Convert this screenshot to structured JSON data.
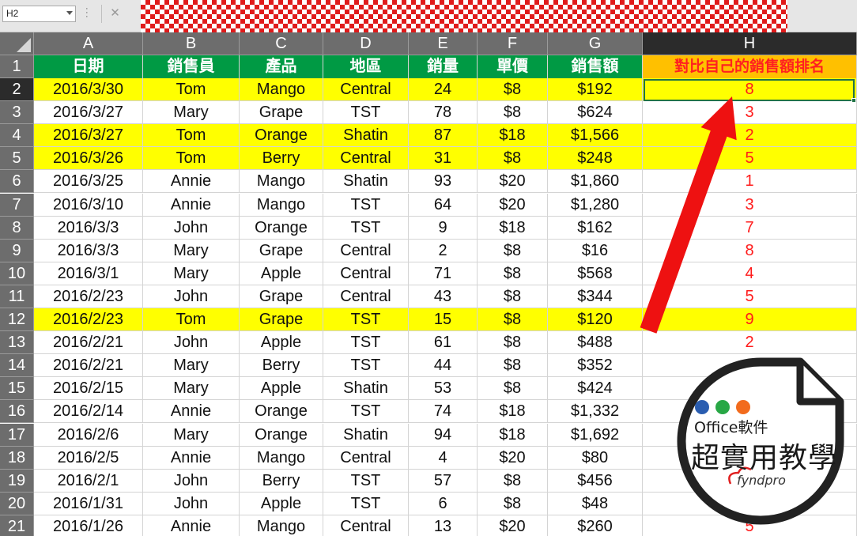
{
  "namebox": "H2",
  "fx_cancel": "✕",
  "columns": [
    "A",
    "B",
    "C",
    "D",
    "E",
    "F",
    "G",
    "H"
  ],
  "selected_column": "H",
  "selected_row": "2",
  "headers": [
    "日期",
    "銷售員",
    "產品",
    "地區",
    "銷量",
    "單價",
    "銷售額",
    "對比自己的銷售額排名"
  ],
  "rows": [
    {
      "n": "2",
      "cells": [
        "2016/3/30",
        "Tom",
        "Mango",
        "Central",
        "24",
        "$8",
        "$192",
        "8"
      ],
      "hl": true
    },
    {
      "n": "3",
      "cells": [
        "2016/3/27",
        "Mary",
        "Grape",
        "TST",
        "78",
        "$8",
        "$624",
        "3"
      ],
      "hl": false
    },
    {
      "n": "4",
      "cells": [
        "2016/3/27",
        "Tom",
        "Orange",
        "Shatin",
        "87",
        "$18",
        "$1,566",
        "2"
      ],
      "hl": true
    },
    {
      "n": "5",
      "cells": [
        "2016/3/26",
        "Tom",
        "Berry",
        "Central",
        "31",
        "$8",
        "$248",
        "5"
      ],
      "hl": true
    },
    {
      "n": "6",
      "cells": [
        "2016/3/25",
        "Annie",
        "Mango",
        "Shatin",
        "93",
        "$20",
        "$1,860",
        "1"
      ],
      "hl": false
    },
    {
      "n": "7",
      "cells": [
        "2016/3/10",
        "Annie",
        "Mango",
        "TST",
        "64",
        "$20",
        "$1,280",
        "3"
      ],
      "hl": false
    },
    {
      "n": "8",
      "cells": [
        "2016/3/3",
        "John",
        "Orange",
        "TST",
        "9",
        "$18",
        "$162",
        "7"
      ],
      "hl": false
    },
    {
      "n": "9",
      "cells": [
        "2016/3/3",
        "Mary",
        "Grape",
        "Central",
        "2",
        "$8",
        "$16",
        "8"
      ],
      "hl": false
    },
    {
      "n": "10",
      "cells": [
        "2016/3/1",
        "Mary",
        "Apple",
        "Central",
        "71",
        "$8",
        "$568",
        "4"
      ],
      "hl": false
    },
    {
      "n": "11",
      "cells": [
        "2016/2/23",
        "John",
        "Grape",
        "Central",
        "43",
        "$8",
        "$344",
        "5"
      ],
      "hl": false
    },
    {
      "n": "12",
      "cells": [
        "2016/2/23",
        "Tom",
        "Grape",
        "TST",
        "15",
        "$8",
        "$120",
        "9"
      ],
      "hl": true
    },
    {
      "n": "13",
      "cells": [
        "2016/2/21",
        "John",
        "Apple",
        "TST",
        "61",
        "$8",
        "$488",
        "2"
      ],
      "hl": false
    },
    {
      "n": "14",
      "cells": [
        "2016/2/21",
        "Mary",
        "Berry",
        "TST",
        "44",
        "$8",
        "$352",
        ""
      ],
      "hl": false
    },
    {
      "n": "15",
      "cells": [
        "2016/2/15",
        "Mary",
        "Apple",
        "Shatin",
        "53",
        "$8",
        "$424",
        ""
      ],
      "hl": false
    },
    {
      "n": "16",
      "cells": [
        "2016/2/14",
        "Annie",
        "Orange",
        "TST",
        "74",
        "$18",
        "$1,332",
        ""
      ],
      "hl": false
    },
    {
      "n": "17",
      "cells": [
        "2016/2/6",
        "Mary",
        "Orange",
        "Shatin",
        "94",
        "$18",
        "$1,692",
        ""
      ],
      "hl": false
    },
    {
      "n": "18",
      "cells": [
        "2016/2/5",
        "Annie",
        "Mango",
        "Central",
        "4",
        "$20",
        "$80",
        ""
      ],
      "hl": false
    },
    {
      "n": "19",
      "cells": [
        "2016/2/1",
        "John",
        "Berry",
        "TST",
        "57",
        "$8",
        "$456",
        ""
      ],
      "hl": false
    },
    {
      "n": "20",
      "cells": [
        "2016/1/31",
        "John",
        "Apple",
        "TST",
        "6",
        "$8",
        "$48",
        ""
      ],
      "hl": false
    },
    {
      "n": "21",
      "cells": [
        "2016/1/26",
        "Annie",
        "Mango",
        "Central",
        "13",
        "$20",
        "$260",
        "5"
      ],
      "hl": false
    }
  ],
  "colors": {
    "highlight": "#ffff00",
    "header_green": "#009a44",
    "header_orange": "#ffc000",
    "rank_red": "#ff1a1a",
    "arrow_red": "#ee1111"
  },
  "logo": {
    "line1": "Office軟件",
    "line2": "超實用教學",
    "brand": "fyndpro",
    "dot_colors": [
      "#2a5db0",
      "#28a745",
      "#f26b1d"
    ]
  }
}
